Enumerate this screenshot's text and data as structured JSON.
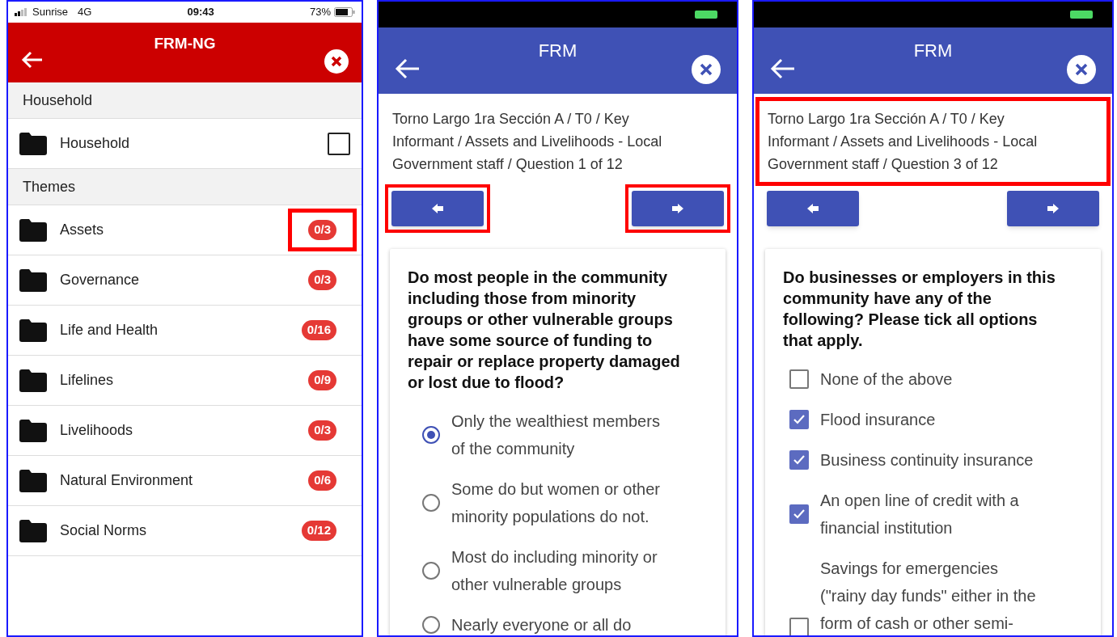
{
  "screens": [
    {
      "kind": "list",
      "status_bar": {
        "carrier": "Sunrise",
        "network": "4G",
        "time": "09:43",
        "battery": "73%"
      },
      "header": {
        "title": "FRM-NG"
      },
      "sections": [
        {
          "title": "Household",
          "items": [
            {
              "label": "Household",
              "kind": "checkbox",
              "checked": false
            }
          ]
        },
        {
          "title": "Themes",
          "items": [
            {
              "label": "Assets",
              "kind": "count",
              "count": "0/3",
              "highlighted": true
            },
            {
              "label": "Governance",
              "kind": "count",
              "count": "0/3",
              "highlighted": false
            },
            {
              "label": "Life and Health",
              "kind": "count",
              "count": "0/16",
              "highlighted": false
            },
            {
              "label": "Lifelines",
              "kind": "count",
              "count": "0/9",
              "highlighted": false
            },
            {
              "label": "Livelihoods",
              "kind": "count",
              "count": "0/3",
              "highlighted": false
            },
            {
              "label": "Natural Environment",
              "kind": "count",
              "count": "0/6",
              "highlighted": false
            },
            {
              "label": "Social Norms",
              "kind": "count",
              "count": "0/12",
              "highlighted": false
            }
          ]
        }
      ]
    },
    {
      "kind": "question",
      "header": {
        "title": "FRM"
      },
      "breadcrumb": {
        "text": "Torno Largo 1ra Sección A / T0 / Key Informant / Assets and Livelihoods - Local Government staff / Question 1 of 12",
        "highlighted": false
      },
      "nav_highlighted": true,
      "question": {
        "text": "Do most people in the community including those from minority groups or other vulnerable groups have some source of funding to repair or replace property damaged or lost due to flood?",
        "kind": "radio",
        "options": [
          {
            "label": "Only the wealthiest members of the community",
            "selected": true
          },
          {
            "label": "Some do but women or other minority populations do not.",
            "selected": false
          },
          {
            "label": "Most do including minority or other vulnerable groups",
            "selected": false
          },
          {
            "label": "Nearly everyone or all do",
            "selected": false
          }
        ]
      }
    },
    {
      "kind": "question",
      "header": {
        "title": "FRM"
      },
      "breadcrumb": {
        "text": "Torno Largo 1ra Sección A / T0 / Key Informant / Assets and Livelihoods - Local Government staff / Question 3 of 12",
        "highlighted": true
      },
      "nav_highlighted": false,
      "question": {
        "text": "Do businesses or employers in this community have any of the following? Please tick all options that apply.",
        "kind": "checkbox",
        "options": [
          {
            "label": "None of the above",
            "checked": false
          },
          {
            "label": "Flood insurance",
            "checked": true
          },
          {
            "label": "Business continuity insurance",
            "checked": true
          },
          {
            "label": "An open line of credit with a financial institution",
            "checked": true
          },
          {
            "label": "Savings for emergencies (\"rainy day funds\" either in the form of cash or other semi-",
            "checked": false
          }
        ]
      }
    }
  ]
}
